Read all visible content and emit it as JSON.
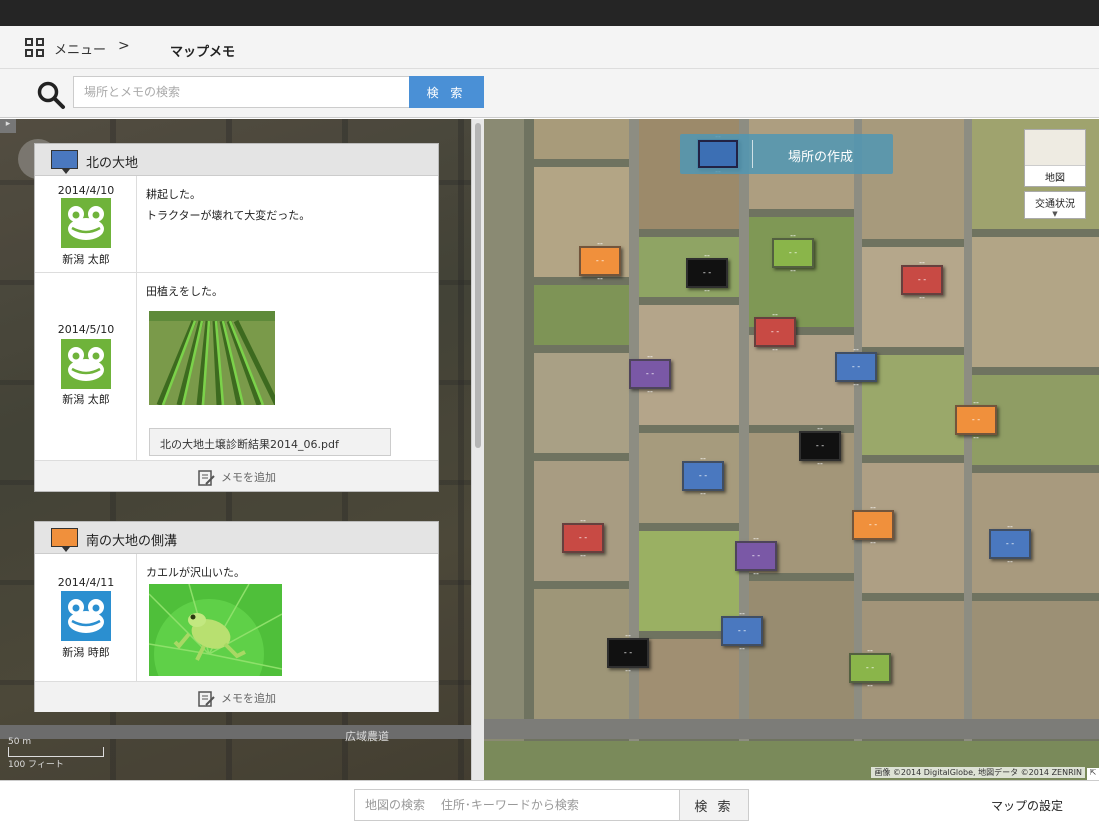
{
  "nav": {
    "menu_label": "メニュー",
    "chevron": ">",
    "title": "マップメモ",
    "menu_icon": "grid-icon"
  },
  "search": {
    "placeholder": "場所とメモの検索",
    "button_label": "検 索",
    "icon": "search-icon"
  },
  "places": [
    {
      "name": "北の大地",
      "color": "#4a78bf",
      "entries": [
        {
          "date": "2014/4/10",
          "user": "新潟 太郎",
          "avatar_color": "#6fb33a",
          "lines": [
            "耕起した。",
            "トラクターが壊れて大変だった。"
          ]
        },
        {
          "date": "2014/5/10",
          "user": "新潟 太郎",
          "avatar_color": "#6fb33a",
          "lines": [
            "田植えをした。"
          ],
          "has_photo": true,
          "attachment": "北の大地土壌診断結果2014_06.pdf"
        }
      ],
      "add_memo": "メモを追加"
    },
    {
      "name": "南の大地の側溝",
      "color": "#f0903c",
      "entries": [
        {
          "date": "2014/4/11",
          "user": "新潟 時郎",
          "avatar_color": "#2b8fd0",
          "lines": [
            "カエルが沢山いた。"
          ],
          "has_photo": true
        }
      ],
      "add_memo": "メモを追加"
    }
  ],
  "left_map": {
    "road_label": "広域農道",
    "scale_metric": "50 m",
    "scale_imperial": "100 フィート"
  },
  "right_map": {
    "create_place_label": "場所の作成",
    "map_type_label": "地図",
    "traffic_label": "交通状況",
    "copyright": "画像 ©2014 DigitalGlobe, 地図データ ©2014 ZENRIN",
    "marker_colors": {
      "blue": "#4a78bf",
      "orange": "#f0903c",
      "black": "#111111",
      "green": "#8ab54a",
      "red": "#c84a44",
      "purple": "#7a58a6"
    }
  },
  "footer": {
    "map_search_placeholder": "地図の検索　 住所･キーワードから検索",
    "map_search_button": "検 索",
    "map_settings": "マップの設定"
  }
}
